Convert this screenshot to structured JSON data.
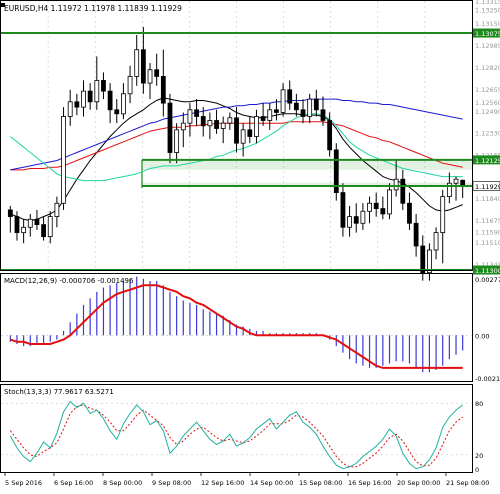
{
  "colors": {
    "background": "#ffffff",
    "frame": "#000000",
    "grid": "#c8c8c8",
    "candle": "#000000",
    "ma_black": "#000000",
    "ma_red": "#e01010",
    "ma_blue": "#1a1ad0",
    "ma_aqua": "#20d8a0",
    "sr_line": "#1c8a1c",
    "sr_fill": "#1c8a1c",
    "price_tag_fill": "#1c8a1c",
    "price_tag_text": "#ffffff",
    "current_tag_fill": "#ffffff",
    "macd_hist": "#3a3ad8",
    "macd_signal": "#e01010",
    "stoch_main": "#20b0a0",
    "stoch_signal": "#e01010",
    "stoch_level": "#c8c8c8"
  },
  "main": {
    "title": "EURUSD,H4  1.11972 1.11978 1.11839 1.11929",
    "price_labels": [
      "1.13315",
      "1.13250",
      "1.13150",
      "1.13075",
      "1.12985",
      "1.12820",
      "1.12655",
      "1.12560",
      "1.12490",
      "1.12330",
      "1.12165",
      "1.12125",
      "1.11929",
      "1.11840",
      "1.11675",
      "1.11590",
      "1.11510",
      "1.11345",
      "1.11300"
    ],
    "current_price": "1.11929"
  },
  "macd": {
    "title": "MACD(12,26,9) -0.000706 -0.001496",
    "labels": [
      "0.002775",
      "0.00",
      "-0.002105"
    ]
  },
  "stoch": {
    "title": "Stoch(13,3,3) 77.9617 63.5271",
    "labels": [
      "80",
      "20",
      "0"
    ]
  },
  "xaxis": {
    "labels": [
      "5 Sep 2016",
      "6 Sep 16:00",
      "8 Sep 00:00",
      "9 Sep 08:00",
      "12 Sep 16:00",
      "14 Sep 00:00",
      "15 Sep 08:00",
      "16 Sep 16:00",
      "20 Sep 00:00",
      "21 Sep 08:00"
    ]
  },
  "chart_data": {
    "type": "candlestick",
    "title": "EURUSD,H4",
    "instrument": "EURUSD",
    "timeframe": "H4",
    "last_ohlc": {
      "open": 1.11972,
      "high": 1.11978,
      "low": 1.11839,
      "close": 1.11929
    },
    "ylim": [
      1.113,
      1.13315
    ],
    "x_tick_labels": [
      "5 Sep 2016",
      "6 Sep 16:00",
      "8 Sep 00:00",
      "9 Sep 08:00",
      "12 Sep 16:00",
      "14 Sep 00:00",
      "15 Sep 08:00",
      "16 Sep 16:00",
      "20 Sep 00:00",
      "21 Sep 08:00"
    ],
    "candles": [
      {
        "o": 1.1175,
        "h": 1.1178,
        "l": 1.1158,
        "c": 1.117
      },
      {
        "o": 1.117,
        "h": 1.1174,
        "l": 1.1152,
        "c": 1.1158
      },
      {
        "o": 1.1158,
        "h": 1.1168,
        "l": 1.115,
        "c": 1.1162
      },
      {
        "o": 1.1162,
        "h": 1.1172,
        "l": 1.1155,
        "c": 1.1168
      },
      {
        "o": 1.1168,
        "h": 1.1175,
        "l": 1.116,
        "c": 1.1164
      },
      {
        "o": 1.1164,
        "h": 1.117,
        "l": 1.1152,
        "c": 1.1155
      },
      {
        "o": 1.1155,
        "h": 1.1174,
        "l": 1.115,
        "c": 1.117
      },
      {
        "o": 1.117,
        "h": 1.1185,
        "l": 1.1162,
        "c": 1.118
      },
      {
        "o": 1.118,
        "h": 1.1252,
        "l": 1.1175,
        "c": 1.1245
      },
      {
        "o": 1.1245,
        "h": 1.1265,
        "l": 1.1238,
        "c": 1.1256
      },
      {
        "o": 1.1256,
        "h": 1.1262,
        "l": 1.1246,
        "c": 1.1252
      },
      {
        "o": 1.1252,
        "h": 1.1272,
        "l": 1.1245,
        "c": 1.1264
      },
      {
        "o": 1.1264,
        "h": 1.127,
        "l": 1.125,
        "c": 1.1256
      },
      {
        "o": 1.1256,
        "h": 1.129,
        "l": 1.125,
        "c": 1.1272
      },
      {
        "o": 1.1272,
        "h": 1.1278,
        "l": 1.1258,
        "c": 1.1264
      },
      {
        "o": 1.1264,
        "h": 1.127,
        "l": 1.124,
        "c": 1.125
      },
      {
        "o": 1.125,
        "h": 1.1258,
        "l": 1.124,
        "c": 1.1247
      },
      {
        "o": 1.1247,
        "h": 1.127,
        "l": 1.1243,
        "c": 1.1262
      },
      {
        "o": 1.1262,
        "h": 1.1283,
        "l": 1.1255,
        "c": 1.1275
      },
      {
        "o": 1.1275,
        "h": 1.1306,
        "l": 1.1268,
        "c": 1.1295
      },
      {
        "o": 1.1295,
        "h": 1.1312,
        "l": 1.1262,
        "c": 1.127
      },
      {
        "o": 1.127,
        "h": 1.1285,
        "l": 1.1258,
        "c": 1.128
      },
      {
        "o": 1.128,
        "h": 1.1292,
        "l": 1.1268,
        "c": 1.1275
      },
      {
        "o": 1.1275,
        "h": 1.1295,
        "l": 1.1245,
        "c": 1.1255
      },
      {
        "o": 1.1255,
        "h": 1.1262,
        "l": 1.121,
        "c": 1.1218
      },
      {
        "o": 1.1218,
        "h": 1.124,
        "l": 1.121,
        "c": 1.1235
      },
      {
        "o": 1.1235,
        "h": 1.1248,
        "l": 1.1222,
        "c": 1.124
      },
      {
        "o": 1.124,
        "h": 1.1255,
        "l": 1.123,
        "c": 1.125
      },
      {
        "o": 1.125,
        "h": 1.1258,
        "l": 1.1238,
        "c": 1.1245
      },
      {
        "o": 1.1245,
        "h": 1.1252,
        "l": 1.123,
        "c": 1.1238
      },
      {
        "o": 1.1238,
        "h": 1.1248,
        "l": 1.1228,
        "c": 1.1242
      },
      {
        "o": 1.1242,
        "h": 1.125,
        "l": 1.1232,
        "c": 1.1236
      },
      {
        "o": 1.1236,
        "h": 1.1245,
        "l": 1.1225,
        "c": 1.124
      },
      {
        "o": 1.124,
        "h": 1.1248,
        "l": 1.1235,
        "c": 1.1244
      },
      {
        "o": 1.1244,
        "h": 1.1252,
        "l": 1.1218,
        "c": 1.1225
      },
      {
        "o": 1.1225,
        "h": 1.124,
        "l": 1.1215,
        "c": 1.1235
      },
      {
        "o": 1.1235,
        "h": 1.1245,
        "l": 1.1225,
        "c": 1.123
      },
      {
        "o": 1.123,
        "h": 1.125,
        "l": 1.1225,
        "c": 1.1245
      },
      {
        "o": 1.1245,
        "h": 1.1255,
        "l": 1.1238,
        "c": 1.1242
      },
      {
        "o": 1.1242,
        "h": 1.1255,
        "l": 1.1235,
        "c": 1.125
      },
      {
        "o": 1.125,
        "h": 1.1258,
        "l": 1.1242,
        "c": 1.1248
      },
      {
        "o": 1.1248,
        "h": 1.127,
        "l": 1.1245,
        "c": 1.1265
      },
      {
        "o": 1.1265,
        "h": 1.1272,
        "l": 1.125,
        "c": 1.1255
      },
      {
        "o": 1.1255,
        "h": 1.1262,
        "l": 1.1245,
        "c": 1.125
      },
      {
        "o": 1.125,
        "h": 1.1258,
        "l": 1.124,
        "c": 1.1245
      },
      {
        "o": 1.1245,
        "h": 1.1262,
        "l": 1.124,
        "c": 1.1258
      },
      {
        "o": 1.1258,
        "h": 1.1265,
        "l": 1.1245,
        "c": 1.125
      },
      {
        "o": 1.125,
        "h": 1.126,
        "l": 1.1238,
        "c": 1.1242
      },
      {
        "o": 1.1242,
        "h": 1.1248,
        "l": 1.1215,
        "c": 1.122
      },
      {
        "o": 1.122,
        "h": 1.1225,
        "l": 1.1182,
        "c": 1.1188
      },
      {
        "o": 1.1188,
        "h": 1.1195,
        "l": 1.1155,
        "c": 1.1162
      },
      {
        "o": 1.1162,
        "h": 1.1178,
        "l": 1.1155,
        "c": 1.117
      },
      {
        "o": 1.117,
        "h": 1.118,
        "l": 1.1158,
        "c": 1.1165
      },
      {
        "o": 1.1165,
        "h": 1.118,
        "l": 1.116,
        "c": 1.1174
      },
      {
        "o": 1.1174,
        "h": 1.1185,
        "l": 1.1165,
        "c": 1.118
      },
      {
        "o": 1.118,
        "h": 1.1188,
        "l": 1.117,
        "c": 1.1176
      },
      {
        "o": 1.1176,
        "h": 1.1185,
        "l": 1.1168,
        "c": 1.1172
      },
      {
        "o": 1.1172,
        "h": 1.1195,
        "l": 1.1168,
        "c": 1.119
      },
      {
        "o": 1.119,
        "h": 1.1212,
        "l": 1.1185,
        "c": 1.1198
      },
      {
        "o": 1.1198,
        "h": 1.1205,
        "l": 1.1175,
        "c": 1.118
      },
      {
        "o": 1.118,
        "h": 1.1188,
        "l": 1.116,
        "c": 1.1165
      },
      {
        "o": 1.1165,
        "h": 1.1172,
        "l": 1.114,
        "c": 1.1148
      },
      {
        "o": 1.1148,
        "h": 1.1156,
        "l": 1.1122,
        "c": 1.1128
      },
      {
        "o": 1.1128,
        "h": 1.115,
        "l": 1.1122,
        "c": 1.1145
      },
      {
        "o": 1.1145,
        "h": 1.1162,
        "l": 1.1138,
        "c": 1.1158
      },
      {
        "o": 1.1158,
        "h": 1.119,
        "l": 1.1135,
        "c": 1.1185
      },
      {
        "o": 1.1185,
        "h": 1.1203,
        "l": 1.118,
        "c": 1.1195
      },
      {
        "o": 1.1195,
        "h": 1.12,
        "l": 1.1182,
        "c": 1.1198
      },
      {
        "o": 1.11972,
        "h": 1.11978,
        "l": 1.11839,
        "c": 1.11929
      }
    ],
    "sr_levels": [
      1.13075,
      1.12125,
      1.11929,
      1.113
    ],
    "sr_zones": [
      [
        1.12125,
        1.1205
      ],
      [
        1.11955,
        1.11929
      ],
      [
        1.1131,
        1.113
      ]
    ],
    "moving_averages": [
      {
        "color": "black",
        "values": [
          1.1172,
          1.117,
          1.1168,
          1.1167,
          1.1168,
          1.117,
          1.1172,
          1.1175,
          1.1182,
          1.119,
          1.1198,
          1.1205,
          1.1212,
          1.1218,
          1.1224,
          1.123,
          1.1235,
          1.124,
          1.1244,
          1.1247,
          1.125,
          1.1254,
          1.1257,
          1.1259,
          1.1258,
          1.1257,
          1.1256,
          1.1256,
          1.1257,
          1.1257,
          1.1256,
          1.1255,
          1.1253,
          1.1251,
          1.1248,
          1.1246,
          1.1245,
          1.1244,
          1.1244,
          1.1245,
          1.1246,
          1.1247,
          1.1247,
          1.1247,
          1.1246,
          1.1246,
          1.1246,
          1.1245,
          1.1242,
          1.1236,
          1.1228,
          1.1222,
          1.1217,
          1.1212,
          1.1208,
          1.1204,
          1.12,
          1.1198,
          1.1197,
          1.1195,
          1.1192,
          1.1188,
          1.1183,
          1.1178,
          1.1175,
          1.1174,
          1.1175,
          1.1177,
          1.1179
        ]
      },
      {
        "color": "red",
        "values": [
          1.1205,
          1.1205,
          1.1205,
          1.1206,
          1.1206,
          1.1206,
          1.1207,
          1.1207,
          1.1208,
          1.121,
          1.1212,
          1.1214,
          1.1216,
          1.1218,
          1.122,
          1.1222,
          1.1224,
          1.1226,
          1.1228,
          1.123,
          1.1232,
          1.1234,
          1.1235,
          1.1236,
          1.1237,
          1.1237,
          1.1237,
          1.1238,
          1.1238,
          1.1239,
          1.1239,
          1.124,
          1.124,
          1.124,
          1.124,
          1.124,
          1.124,
          1.124,
          1.124,
          1.124,
          1.124,
          1.124,
          1.1241,
          1.1241,
          1.1241,
          1.1241,
          1.1241,
          1.1241,
          1.124,
          1.1239,
          1.1238,
          1.1236,
          1.1234,
          1.1232,
          1.123,
          1.1229,
          1.1227,
          1.1226,
          1.1224,
          1.1222,
          1.122,
          1.1218,
          1.1216,
          1.1214,
          1.1212,
          1.121,
          1.1209,
          1.1208,
          1.1207
        ]
      },
      {
        "color": "blue",
        "values": [
          1.1205,
          1.1206,
          1.1207,
          1.1208,
          1.1209,
          1.121,
          1.1211,
          1.1212,
          1.1214,
          1.1216,
          1.1218,
          1.122,
          1.1222,
          1.1224,
          1.1226,
          1.1228,
          1.123,
          1.1232,
          1.1234,
          1.1236,
          1.1238,
          1.124,
          1.1241,
          1.1243,
          1.1244,
          1.1245,
          1.1246,
          1.1247,
          1.1248,
          1.1249,
          1.125,
          1.1251,
          1.1252,
          1.1252,
          1.1253,
          1.1253,
          1.1254,
          1.1254,
          1.1255,
          1.1255,
          1.1256,
          1.1256,
          1.1257,
          1.1257,
          1.1257,
          1.1258,
          1.1258,
          1.1258,
          1.1258,
          1.1258,
          1.1257,
          1.1257,
          1.1256,
          1.1256,
          1.1255,
          1.1255,
          1.1254,
          1.1254,
          1.1253,
          1.1252,
          1.1251,
          1.125,
          1.1249,
          1.1248,
          1.1247,
          1.1246,
          1.1245,
          1.1244,
          1.1243
        ]
      },
      {
        "color": "aqua",
        "values": [
          1.123,
          1.1226,
          1.1222,
          1.1218,
          1.1214,
          1.121,
          1.1206,
          1.1202,
          1.12,
          1.1199,
          1.1198,
          1.1197,
          1.1197,
          1.1197,
          1.1197,
          1.1198,
          1.1199,
          1.12,
          1.1201,
          1.1202,
          1.1204,
          1.1206,
          1.1207,
          1.1208,
          1.1208,
          1.1208,
          1.1209,
          1.121,
          1.1211,
          1.1212,
          1.1213,
          1.1215,
          1.1216,
          1.1218,
          1.122,
          1.1221,
          1.1223,
          1.1225,
          1.1228,
          1.1231,
          1.1234,
          1.1238,
          1.1241,
          1.1244,
          1.1246,
          1.1247,
          1.1247,
          1.1246,
          1.1243,
          1.1238,
          1.1232,
          1.1226,
          1.1222,
          1.1219,
          1.1216,
          1.1214,
          1.1212,
          1.121,
          1.1208,
          1.1206,
          1.1205,
          1.1204,
          1.1203,
          1.1202,
          1.1201,
          1.12,
          1.12,
          1.12,
          1.12
        ]
      }
    ],
    "macd": {
      "ylim": [
        -0.002105,
        0.002775
      ],
      "histogram": [
        -0.0003,
        -0.0004,
        -0.0005,
        -0.0005,
        -0.0004,
        -0.0004,
        -0.0003,
        -0.0002,
        0.0002,
        0.0006,
        0.001,
        0.0014,
        0.0017,
        0.002,
        0.0022,
        0.0023,
        0.0024,
        0.0025,
        0.0026,
        0.0027,
        0.0026,
        0.0025,
        0.0025,
        0.0023,
        0.002,
        0.0018,
        0.0016,
        0.0015,
        0.0014,
        0.0012,
        0.0011,
        0.001,
        0.0009,
        0.0007,
        0.0005,
        0.0004,
        0.0003,
        0.0002,
        0.0002,
        0.0001,
        0.0001,
        0.0001,
        0.0001,
        0.0001,
        0.0001,
        0.0001,
        0.0001,
        0.0,
        -0.0002,
        -0.0005,
        -0.0008,
        -0.0011,
        -0.0013,
        -0.0014,
        -0.0015,
        -0.0015,
        -0.0014,
        -0.0013,
        -0.0012,
        -0.0012,
        -0.0013,
        -0.0015,
        -0.0017,
        -0.0017,
        -0.0016,
        -0.0014,
        -0.0011,
        -0.0009,
        -0.0007
      ],
      "signal": [
        -0.0002,
        -0.0003,
        -0.0003,
        -0.0004,
        -0.0004,
        -0.0004,
        -0.0004,
        -0.0003,
        -0.0002,
        0.0,
        0.0003,
        0.0006,
        0.0009,
        0.0012,
        0.0015,
        0.0017,
        0.0019,
        0.002,
        0.0021,
        0.0022,
        0.0023,
        0.0023,
        0.0023,
        0.0022,
        0.0021,
        0.002,
        0.0018,
        0.0017,
        0.0015,
        0.0014,
        0.0012,
        0.001,
        0.0008,
        0.0006,
        0.0004,
        0.0003,
        0.0001,
        0.0,
        0.0,
        0.0,
        0.0,
        0.0,
        0.0,
        0.0,
        0.0,
        0.0,
        0.0,
        0.0,
        -0.0001,
        -0.0002,
        -0.0004,
        -0.0006,
        -0.0008,
        -0.001,
        -0.0012,
        -0.0014,
        -0.0015,
        -0.0015,
        -0.0015,
        -0.0015,
        -0.0015,
        -0.0015,
        -0.0015,
        -0.0015,
        -0.0015,
        -0.0015,
        -0.0015,
        -0.0015,
        -0.0015
      ]
    },
    "stochastic": {
      "ylim": [
        0,
        100
      ],
      "levels": [
        80,
        20
      ],
      "main": [
        42,
        28,
        18,
        12,
        22,
        35,
        28,
        45,
        70,
        82,
        75,
        80,
        68,
        72,
        62,
        48,
        38,
        56,
        68,
        78,
        70,
        55,
        60,
        48,
        22,
        30,
        42,
        50,
        58,
        48,
        38,
        32,
        36,
        44,
        30,
        34,
        40,
        50,
        56,
        62,
        50,
        58,
        66,
        70,
        58,
        52,
        44,
        30,
        18,
        8,
        4,
        6,
        10,
        18,
        24,
        30,
        38,
        50,
        42,
        22,
        10,
        4,
        6,
        14,
        28,
        52,
        64,
        72,
        78
      ],
      "signal": [
        48,
        38,
        28,
        20,
        18,
        24,
        28,
        34,
        50,
        68,
        76,
        78,
        74,
        72,
        66,
        58,
        48,
        48,
        56,
        66,
        72,
        66,
        60,
        54,
        40,
        32,
        36,
        44,
        50,
        52,
        46,
        40,
        36,
        38,
        36,
        34,
        36,
        42,
        48,
        56,
        56,
        56,
        60,
        66,
        64,
        58,
        50,
        42,
        30,
        18,
        10,
        6,
        6,
        10,
        16,
        22,
        30,
        40,
        44,
        36,
        24,
        12,
        7,
        8,
        16,
        32,
        48,
        58,
        64
      ]
    }
  }
}
